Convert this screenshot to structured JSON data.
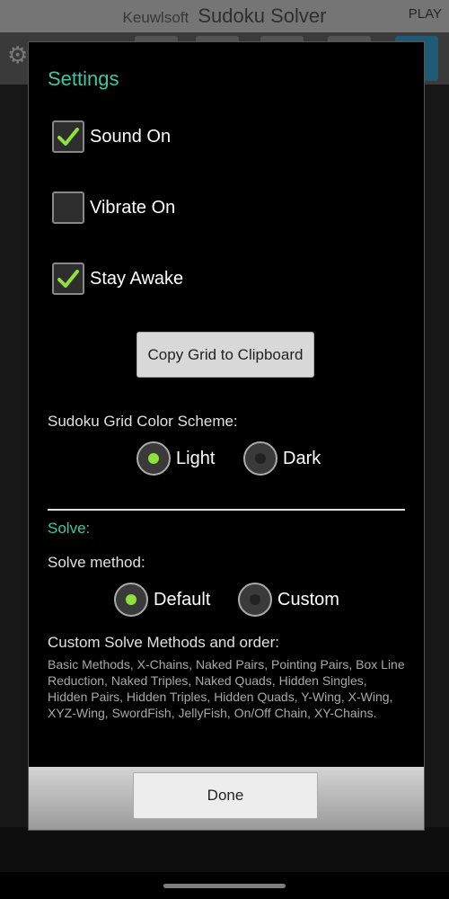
{
  "app": {
    "brand": "Keuwlsoft",
    "title": "Sudoku Solver",
    "play_label": "PLAY"
  },
  "dialog": {
    "title": "Settings",
    "checkboxes": [
      {
        "label": "Sound On",
        "checked": true
      },
      {
        "label": "Vibrate On",
        "checked": false
      },
      {
        "label": "Stay Awake",
        "checked": true
      }
    ],
    "copy_button": "Copy Grid to Clipboard",
    "color_scheme": {
      "label": "Sudoku Grid Color Scheme:",
      "options": [
        {
          "label": "Light",
          "selected": true
        },
        {
          "label": "Dark",
          "selected": false
        }
      ]
    },
    "solve_section": "Solve:",
    "solve_method": {
      "label": "Solve method:",
      "options": [
        {
          "label": "Default",
          "selected": true
        },
        {
          "label": "Custom",
          "selected": false
        }
      ]
    },
    "custom_methods_label": "Custom Solve Methods and order:",
    "custom_methods_text": "Basic Methods, X-Chains, Naked Pairs, Pointing Pairs, Box Line Reduction, Naked Triples, Naked Quads, Hidden Singles, Hidden Pairs, Hidden Triples, Hidden Quads, Y-Wing, X-Wing, XYZ-Wing, SwordFish, JellyFish, On/Off Chain, XY-Chains.",
    "done_button": "Done"
  },
  "colors": {
    "accent": "#3ec6a4",
    "check": "#8ee03a",
    "dialog_bg": "#000000"
  }
}
